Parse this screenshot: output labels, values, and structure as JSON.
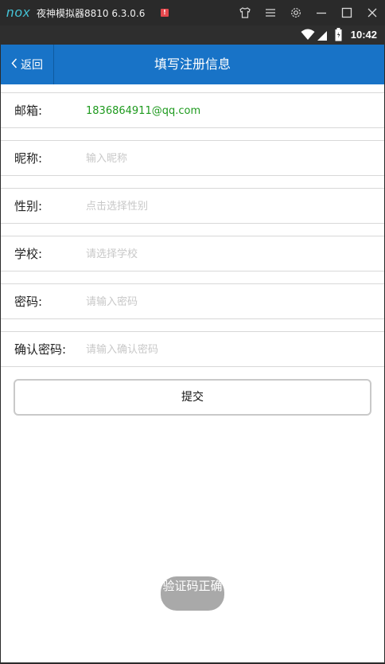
{
  "emulator": {
    "logo": "nox",
    "title": "夜神模拟器8810 6.3.0.6",
    "badge": "!",
    "icons": [
      "shirt-icon",
      "menu-icon",
      "gear-icon",
      "minimize-icon",
      "maximize-icon",
      "close-icon"
    ]
  },
  "statusbar": {
    "time": "10:42",
    "icons": [
      "wifi-icon",
      "signal-icon",
      "battery-icon"
    ]
  },
  "appbar": {
    "back_label": "返回",
    "title": "填写注册信息"
  },
  "form": {
    "email": {
      "label": "邮箱:",
      "value": "1836864911@qq.com"
    },
    "nickname": {
      "label": "昵称:",
      "placeholder": "输入昵称"
    },
    "gender": {
      "label": "性别:",
      "placeholder": "点击选择性别"
    },
    "school": {
      "label": "学校:",
      "placeholder": "请选择学校"
    },
    "password": {
      "label": "密码:",
      "placeholder": "请输入密码"
    },
    "confirm": {
      "label": "确认密码:",
      "placeholder": "请输入确认密码"
    },
    "submit_label": "提交"
  },
  "toast": {
    "text": "验证码正确"
  },
  "colors": {
    "appbar": "#1873c7",
    "email_value": "#1e9a1e",
    "nox_logo": "#44c3d6"
  }
}
